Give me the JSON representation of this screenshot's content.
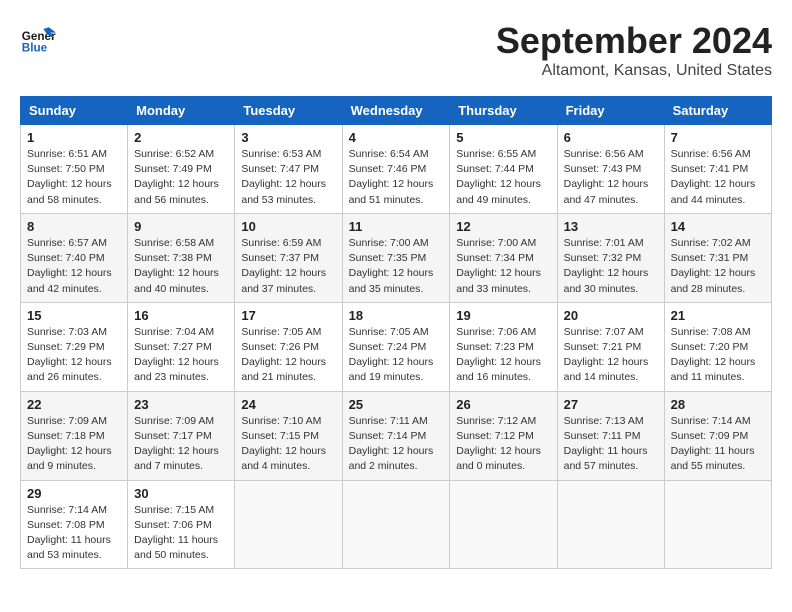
{
  "logo": {
    "line1": "General",
    "line2": "Blue"
  },
  "title": "September 2024",
  "location": "Altamont, Kansas, United States",
  "weekdays": [
    "Sunday",
    "Monday",
    "Tuesday",
    "Wednesday",
    "Thursday",
    "Friday",
    "Saturday"
  ],
  "weeks": [
    [
      {
        "day": "1",
        "sunrise": "6:51 AM",
        "sunset": "7:50 PM",
        "daylight": "12 hours and 58 minutes."
      },
      {
        "day": "2",
        "sunrise": "6:52 AM",
        "sunset": "7:49 PM",
        "daylight": "12 hours and 56 minutes."
      },
      {
        "day": "3",
        "sunrise": "6:53 AM",
        "sunset": "7:47 PM",
        "daylight": "12 hours and 53 minutes."
      },
      {
        "day": "4",
        "sunrise": "6:54 AM",
        "sunset": "7:46 PM",
        "daylight": "12 hours and 51 minutes."
      },
      {
        "day": "5",
        "sunrise": "6:55 AM",
        "sunset": "7:44 PM",
        "daylight": "12 hours and 49 minutes."
      },
      {
        "day": "6",
        "sunrise": "6:56 AM",
        "sunset": "7:43 PM",
        "daylight": "12 hours and 47 minutes."
      },
      {
        "day": "7",
        "sunrise": "6:56 AM",
        "sunset": "7:41 PM",
        "daylight": "12 hours and 44 minutes."
      }
    ],
    [
      {
        "day": "8",
        "sunrise": "6:57 AM",
        "sunset": "7:40 PM",
        "daylight": "12 hours and 42 minutes."
      },
      {
        "day": "9",
        "sunrise": "6:58 AM",
        "sunset": "7:38 PM",
        "daylight": "12 hours and 40 minutes."
      },
      {
        "day": "10",
        "sunrise": "6:59 AM",
        "sunset": "7:37 PM",
        "daylight": "12 hours and 37 minutes."
      },
      {
        "day": "11",
        "sunrise": "7:00 AM",
        "sunset": "7:35 PM",
        "daylight": "12 hours and 35 minutes."
      },
      {
        "day": "12",
        "sunrise": "7:00 AM",
        "sunset": "7:34 PM",
        "daylight": "12 hours and 33 minutes."
      },
      {
        "day": "13",
        "sunrise": "7:01 AM",
        "sunset": "7:32 PM",
        "daylight": "12 hours and 30 minutes."
      },
      {
        "day": "14",
        "sunrise": "7:02 AM",
        "sunset": "7:31 PM",
        "daylight": "12 hours and 28 minutes."
      }
    ],
    [
      {
        "day": "15",
        "sunrise": "7:03 AM",
        "sunset": "7:29 PM",
        "daylight": "12 hours and 26 minutes."
      },
      {
        "day": "16",
        "sunrise": "7:04 AM",
        "sunset": "7:27 PM",
        "daylight": "12 hours and 23 minutes."
      },
      {
        "day": "17",
        "sunrise": "7:05 AM",
        "sunset": "7:26 PM",
        "daylight": "12 hours and 21 minutes."
      },
      {
        "day": "18",
        "sunrise": "7:05 AM",
        "sunset": "7:24 PM",
        "daylight": "12 hours and 19 minutes."
      },
      {
        "day": "19",
        "sunrise": "7:06 AM",
        "sunset": "7:23 PM",
        "daylight": "12 hours and 16 minutes."
      },
      {
        "day": "20",
        "sunrise": "7:07 AM",
        "sunset": "7:21 PM",
        "daylight": "12 hours and 14 minutes."
      },
      {
        "day": "21",
        "sunrise": "7:08 AM",
        "sunset": "7:20 PM",
        "daylight": "12 hours and 11 minutes."
      }
    ],
    [
      {
        "day": "22",
        "sunrise": "7:09 AM",
        "sunset": "7:18 PM",
        "daylight": "12 hours and 9 minutes."
      },
      {
        "day": "23",
        "sunrise": "7:09 AM",
        "sunset": "7:17 PM",
        "daylight": "12 hours and 7 minutes."
      },
      {
        "day": "24",
        "sunrise": "7:10 AM",
        "sunset": "7:15 PM",
        "daylight": "12 hours and 4 minutes."
      },
      {
        "day": "25",
        "sunrise": "7:11 AM",
        "sunset": "7:14 PM",
        "daylight": "12 hours and 2 minutes."
      },
      {
        "day": "26",
        "sunrise": "7:12 AM",
        "sunset": "7:12 PM",
        "daylight": "12 hours and 0 minutes."
      },
      {
        "day": "27",
        "sunrise": "7:13 AM",
        "sunset": "7:11 PM",
        "daylight": "11 hours and 57 minutes."
      },
      {
        "day": "28",
        "sunrise": "7:14 AM",
        "sunset": "7:09 PM",
        "daylight": "11 hours and 55 minutes."
      }
    ],
    [
      {
        "day": "29",
        "sunrise": "7:14 AM",
        "sunset": "7:08 PM",
        "daylight": "11 hours and 53 minutes."
      },
      {
        "day": "30",
        "sunrise": "7:15 AM",
        "sunset": "7:06 PM",
        "daylight": "11 hours and 50 minutes."
      },
      null,
      null,
      null,
      null,
      null
    ]
  ],
  "labels": {
    "sunrise": "Sunrise:",
    "sunset": "Sunset:",
    "daylight": "Daylight:"
  }
}
